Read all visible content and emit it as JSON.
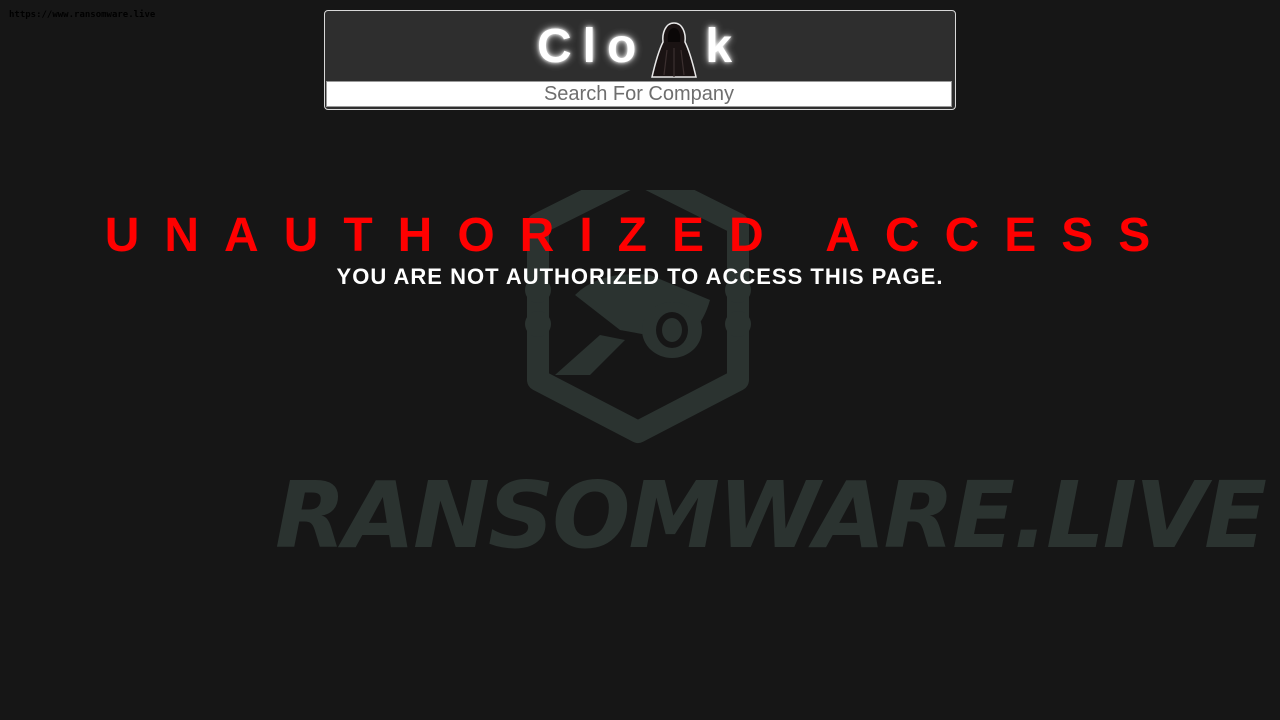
{
  "url_stamp": "https://www.ransomware.live",
  "header": {
    "logo_left": "Clo",
    "logo_right": "k",
    "logo_icon": "hooded-cloak-icon",
    "search": {
      "value": "",
      "placeholder": "Search For Company"
    }
  },
  "main": {
    "title": "UNAUTHORIZED ACCESS",
    "message": "YOU ARE NOT AUTHORIZED TO ACCESS THIS PAGE."
  },
  "watermark": {
    "text": "RANSOMWARE.LIVE",
    "icon": "cctv-hexagon-icon"
  },
  "colors": {
    "background": "#161616",
    "title": "#ff0000",
    "watermark": "#2b3330"
  }
}
